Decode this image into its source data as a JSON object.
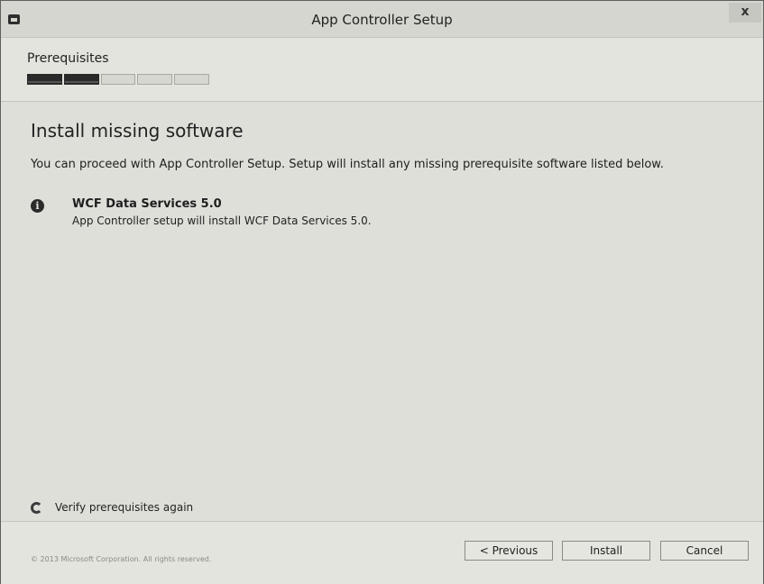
{
  "window": {
    "title": "App Controller Setup",
    "close_label": "x"
  },
  "header": {
    "step_label": "Prerequisites",
    "progress": {
      "total_steps": 5,
      "completed_steps": 2
    }
  },
  "main": {
    "heading": "Install missing software",
    "description": "You can proceed with App Controller Setup. Setup will install any missing prerequisite software listed below.",
    "items": [
      {
        "icon": "info-icon",
        "title": "WCF Data Services 5.0",
        "description": "App Controller setup will install WCF Data Services 5.0."
      }
    ],
    "verify_link": "Verify prerequisites again"
  },
  "footer": {
    "copyright": "© 2013 Microsoft Corporation. All rights reserved.",
    "buttons": {
      "previous": "< Previous",
      "install": "Install",
      "cancel": "Cancel"
    }
  },
  "colors": {
    "window_bg": "#dcdcd6",
    "progress_done": "#2a2a2a"
  }
}
